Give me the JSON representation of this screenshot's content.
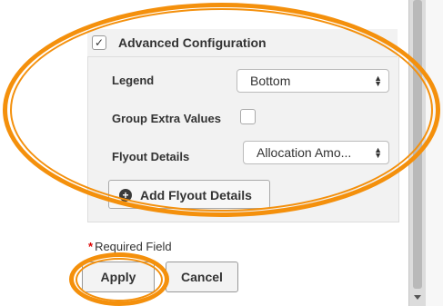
{
  "panel": {
    "title": "Advanced Configuration",
    "checked_mark": "✓",
    "fields": {
      "legend_label": "Legend",
      "legend_value": "Bottom",
      "group_extra_label": "Group Extra Values",
      "flyout_label": "Flyout Details",
      "flyout_value": "Allocation Amo..."
    },
    "add_flyout_button": "Add Flyout Details",
    "plus_glyph": "+"
  },
  "footer": {
    "required_star": "*",
    "required_text": "Required Field",
    "apply": "Apply",
    "cancel": "Cancel"
  },
  "icons": {
    "select_arrows": "▲▼",
    "highlight_color": "#f4900c"
  }
}
